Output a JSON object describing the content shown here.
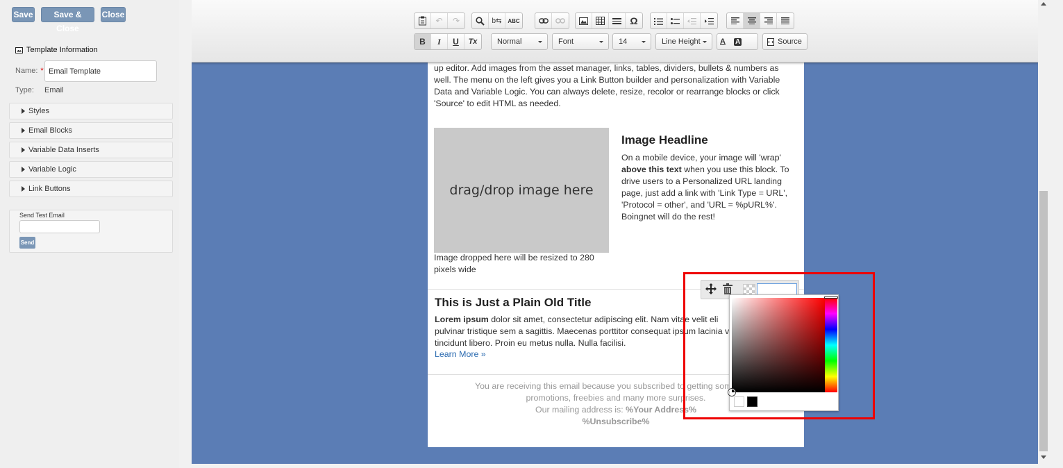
{
  "sidebar": {
    "buttons": {
      "save": "Save",
      "save_close": "Save & Close",
      "close": "Close"
    },
    "template_info": {
      "title": "Template Information",
      "name_label": "Name:",
      "name_required": "*",
      "name_value": "Email Template",
      "type_label": "Type:",
      "type_value": "Email"
    },
    "accordions": [
      "Styles",
      "Email Blocks",
      "Variable Data Inserts",
      "Variable Logic",
      "Link Buttons"
    ],
    "send_test": {
      "label": "Send Test Email",
      "input_value": "",
      "button": "Send"
    }
  },
  "toolbar": {
    "row1_icons": [
      "paste-text-icon",
      "undo-icon",
      "redo-icon",
      "find-icon",
      "replace-icon",
      "spellcheck-icon",
      "link-icon",
      "unlink-icon",
      "image-icon",
      "table-icon",
      "horizontal-rule-icon",
      "special-char-icon",
      "numbered-list-icon",
      "bulleted-list-icon",
      "outdent-icon",
      "indent-icon",
      "align-left-icon",
      "align-center-icon",
      "align-right-icon",
      "justify-icon"
    ],
    "row2": {
      "bold": "B",
      "italic": "I",
      "underline": "U",
      "clear_format": "Tx",
      "format": "Normal",
      "font": "Font",
      "size": "14",
      "line_height": "Line Height",
      "text_color": "A",
      "bg_color": "A",
      "source": "Source"
    }
  },
  "email": {
    "intro": "up editor. Add images from the asset manager, links, tables, dividers, bullets & numbers as well. The menu on the left gives you a Link Button builder and personalization with Variable Data and Variable Logic. You can always delete, resize, recolor or rearrange blocks or click 'Source' to edit HTML as needed.",
    "image_placeholder": "drag/drop image here",
    "image_caption": "Image dropped here will be resized to 280 pixels wide",
    "image_headline": "Image Headline",
    "image_text_1": "On a mobile device, your image will 'wrap'",
    "image_text_bold": "above this text",
    "image_text_2": "when you use this block. To drive users to a Personalized URL landing page, just add a link with 'Link Type = URL', 'Protocol = other', and 'URL = %pURL%'. Boingnet will do the rest!",
    "plain_title": "This is Just a Plain Old Title",
    "plain_bold": "Lorem ipsum",
    "plain_text": "dolor sit amet, consectetur adipiscing elit. Nam vitae velit eli pulvinar tristique sem a sagittis. Maecenas porttitor consequat ipsum lacinia vitae tincidunt libero. Proin eu metus nulla. Nulla facilisi.",
    "learn_more": "Learn More »",
    "footer_line1": "You are receiving this email because you subscribed to getting some spec",
    "footer_line2": "promotions, freebies and many more surprises.",
    "footer_line3_label": "Our mailing address is:",
    "footer_line3_value": "%Your Address%",
    "footer_line4": "%Unsubscribe%"
  },
  "color_picker": {
    "input_value": "",
    "hue_color": "#ff0000",
    "palette": [
      "#ffffff",
      "#000000"
    ]
  },
  "colors": {
    "canvas_bg": "#5b7db5",
    "button_bg": "#7a96b6",
    "highlight": "#ee0000",
    "link": "#2a6ab0"
  }
}
